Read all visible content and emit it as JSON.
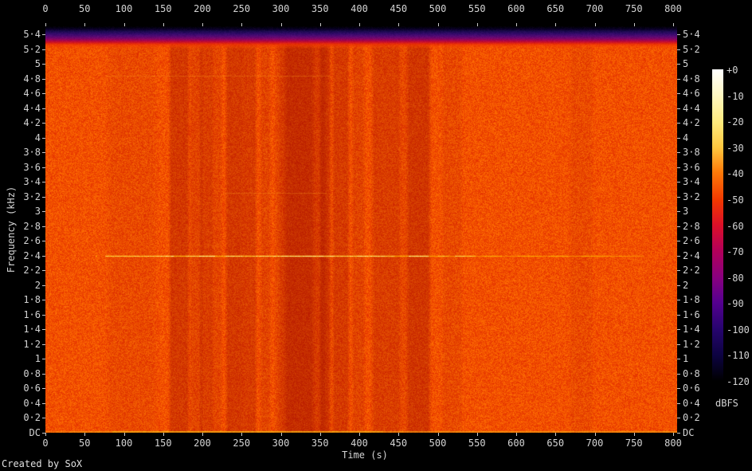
{
  "app": {
    "credit": "Created by SoX"
  },
  "chart_data": {
    "type": "heatmap",
    "subtype": "audio-spectrogram",
    "xlabel": "Time (s)",
    "ylabel": "Frequency (kHz)",
    "x_ticks": [
      0,
      50,
      100,
      150,
      200,
      250,
      300,
      350,
      400,
      450,
      500,
      550,
      600,
      650,
      700,
      750,
      800
    ],
    "x_range_s": [
      0,
      805
    ],
    "y_tick_labels": [
      "DC",
      "0·2",
      "0·4",
      "0·6",
      "0·8",
      "1",
      "1·2",
      "1·4",
      "1·6",
      "1·8",
      "2",
      "2·2",
      "2·4",
      "2·6",
      "2·8",
      "3",
      "3·2",
      "3·4",
      "3·6",
      "3·8",
      "4",
      "4·2",
      "4·4",
      "4·6",
      "4·8",
      "5",
      "5·2",
      "5·4"
    ],
    "y_tick_step_khz": 0.2,
    "y_max_khz": 5.5125,
    "colorbar": {
      "label": "dBFS",
      "tick_labels": [
        "+0",
        "-10",
        "-20",
        "-30",
        "-40",
        "-50",
        "-60",
        "-70",
        "-80",
        "-90",
        "-100",
        "-110",
        "-120"
      ],
      "range_db": [
        0,
        -120
      ],
      "palette": [
        [
          0.0,
          "#ffffff"
        ],
        [
          0.08,
          "#fff8c4"
        ],
        [
          0.17,
          "#ffea7c"
        ],
        [
          0.25,
          "#ffc840"
        ],
        [
          0.33,
          "#ff7a08"
        ],
        [
          0.42,
          "#f23800"
        ],
        [
          0.5,
          "#dc1028"
        ],
        [
          0.58,
          "#b40058"
        ],
        [
          0.67,
          "#880080"
        ],
        [
          0.75,
          "#540090"
        ],
        [
          0.83,
          "#280470"
        ],
        [
          0.92,
          "#0c0340"
        ],
        [
          1.0,
          "#000000"
        ]
      ]
    },
    "background_texture": {
      "level_db_approx": -45,
      "color_dark": "#e43000",
      "color_bright": "#ff7000"
    },
    "nyquist_rolloff_band": {
      "desc": "dark band above ~5.2 kHz fading black->blue->purple->magenta->red into body",
      "stops": [
        [
          0,
          "#000006"
        ],
        [
          3,
          "#0a0026"
        ],
        [
          6,
          "#1c0a50"
        ],
        [
          9,
          "#340a6a"
        ],
        [
          12,
          "#540a74"
        ],
        [
          15,
          "#7c0668"
        ],
        [
          17,
          "#a00450"
        ],
        [
          19,
          "#c40c30"
        ],
        [
          21,
          "#e02410"
        ],
        [
          23,
          "#f03800"
        ],
        [
          26,
          "#f84400"
        ],
        [
          28,
          "#fa4a00"
        ]
      ]
    },
    "quiet_vertical_bands_s": [
      [
        85,
        135,
        0.13
      ],
      [
        160,
        180,
        0.5
      ],
      [
        186,
        197,
        0.26
      ],
      [
        199,
        210,
        0.4
      ],
      [
        213,
        222,
        0.24
      ],
      [
        232,
        248,
        0.5
      ],
      [
        252,
        266,
        0.44
      ],
      [
        276,
        284,
        0.26
      ],
      [
        300,
        352,
        0.45
      ],
      [
        308,
        338,
        0.3
      ],
      [
        352,
        361,
        0.45
      ],
      [
        368,
        384,
        0.46
      ],
      [
        393,
        404,
        0.28
      ],
      [
        419,
        447,
        0.4
      ],
      [
        450,
        458,
        0.18
      ],
      [
        463,
        487,
        0.55
      ],
      [
        508,
        528,
        0.16
      ],
      [
        671,
        694,
        0.13
      ]
    ],
    "tone_lines": [
      {
        "khz": 2.4,
        "style": "bright",
        "segments_s": [
          [
            64,
            66,
            0.5
          ],
          [
            76,
            140,
            0.8
          ],
          [
            140,
            163,
            0.9
          ],
          [
            163,
            180,
            0.65
          ],
          [
            180,
            196,
            0.85
          ],
          [
            196,
            216,
            1.0
          ],
          [
            216,
            228,
            0.6
          ],
          [
            228,
            252,
            0.85
          ],
          [
            252,
            268,
            0.7
          ],
          [
            268,
            305,
            0.9
          ],
          [
            305,
            340,
            1.0
          ],
          [
            340,
            370,
            0.95
          ],
          [
            370,
            385,
            0.75
          ],
          [
            385,
            400,
            0.85
          ],
          [
            400,
            422,
            0.95
          ],
          [
            422,
            445,
            0.8
          ],
          [
            445,
            463,
            0.55
          ],
          [
            463,
            488,
            1.0
          ],
          [
            488,
            500,
            0.45
          ],
          [
            500,
            514,
            0.7
          ],
          [
            514,
            522,
            0.25
          ],
          [
            522,
            548,
            0.75
          ],
          [
            548,
            558,
            0.2
          ],
          [
            558,
            582,
            0.55
          ],
          [
            582,
            602,
            0.25
          ],
          [
            602,
            632,
            0.5
          ],
          [
            632,
            642,
            0.2
          ],
          [
            642,
            666,
            0.55
          ],
          [
            666,
            682,
            0.25
          ],
          [
            682,
            714,
            0.5
          ],
          [
            714,
            742,
            0.3
          ],
          [
            742,
            762,
            0.2
          ]
        ]
      },
      {
        "khz": 4.84,
        "style": "faint",
        "segments_s": [
          [
            78,
            362,
            0.3
          ]
        ]
      },
      {
        "khz": 3.25,
        "style": "faint",
        "segments_s": [
          [
            226,
            358,
            0.28
          ]
        ]
      }
    ],
    "dc_line_segments_s": [
      [
        0,
        30,
        0.35
      ],
      [
        30,
        85,
        0.5
      ],
      [
        85,
        430,
        0.8
      ],
      [
        430,
        805,
        0.55
      ]
    ]
  }
}
